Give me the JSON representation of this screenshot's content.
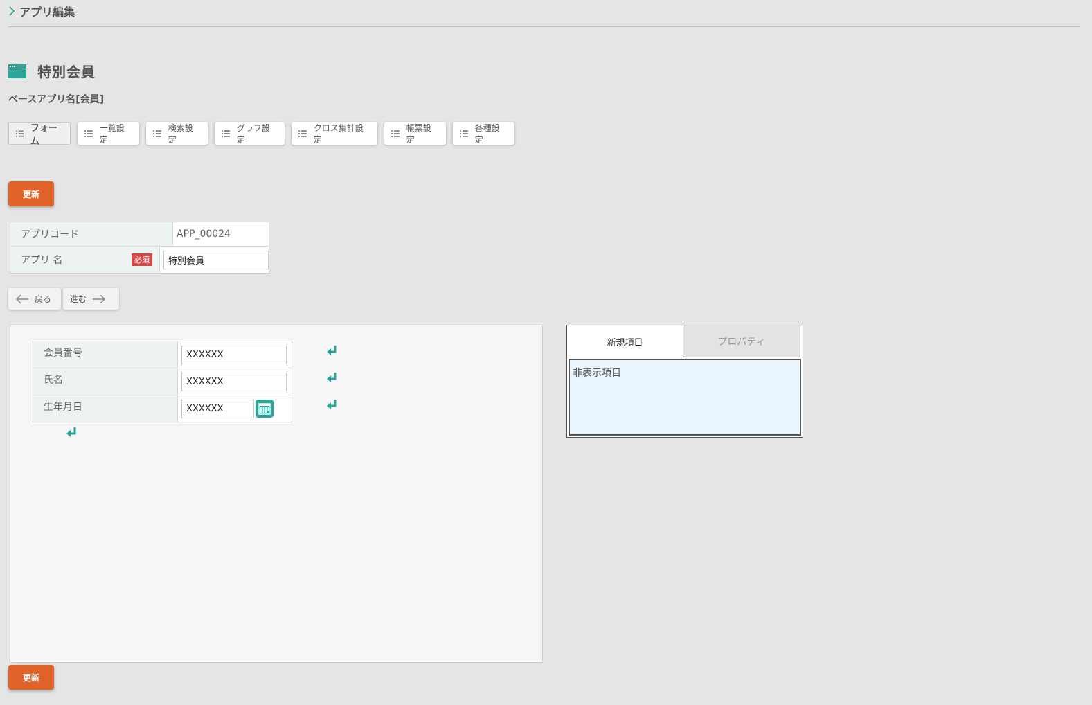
{
  "header": {
    "breadcrumb": "アプリ編集",
    "title": "特別会員",
    "base_app": "ベースアプリ名[会員]"
  },
  "tabs": [
    {
      "label": "フォーム",
      "active": true
    },
    {
      "label": "一覧設定"
    },
    {
      "label": "検索設定"
    },
    {
      "label": "グラフ設定"
    },
    {
      "label": "クロス集計設定"
    },
    {
      "label": "帳票設定"
    },
    {
      "label": "各種設定"
    }
  ],
  "actions": {
    "update_label": "更新",
    "back_label": "戻る",
    "forward_label": "進む"
  },
  "app_info": {
    "code_label": "アプリコード",
    "code_value": "APP_00024",
    "name_label": "アプリ 名",
    "required_badge": "必須",
    "name_value": "特別会員"
  },
  "form": {
    "fields": [
      {
        "label": "会員番号",
        "value": "XXXXXX"
      },
      {
        "label": "氏名",
        "value": "XXXXXX"
      },
      {
        "label": "生年月日",
        "value": "XXXXXX",
        "has_calendar": true
      }
    ]
  },
  "panel": {
    "tab_new": "新規項目",
    "tab_properties": "プロパティ",
    "hidden_items": "非表示項目"
  },
  "colors": {
    "accent": "#2aa79b",
    "button": "#e0642a",
    "required": "#d24b4b",
    "background": "#e5e5e5"
  }
}
